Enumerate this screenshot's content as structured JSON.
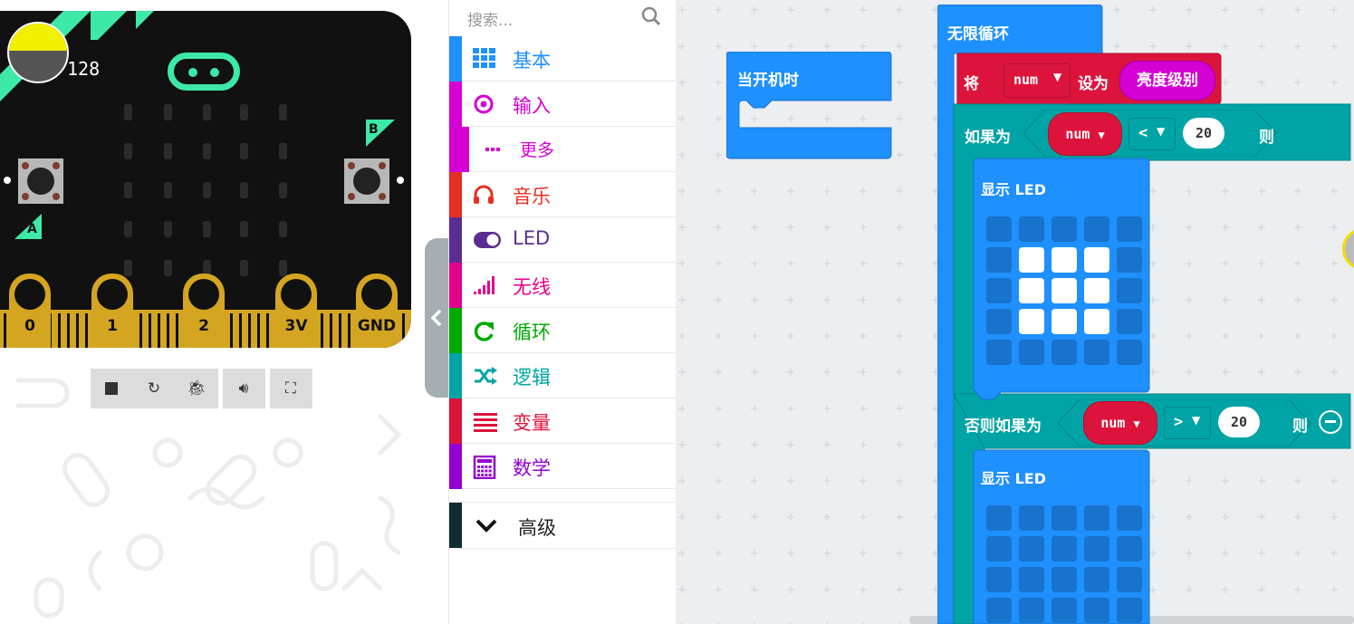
{
  "simulator": {
    "light_level": "128",
    "buttons": {
      "a": "A",
      "b": "B"
    },
    "pins": [
      "0",
      "1",
      "2",
      "3V",
      "GND"
    ],
    "controls": [
      "stop-icon",
      "restart-icon",
      "debug-icon",
      "mute-icon",
      "fullscreen-icon"
    ]
  },
  "toolbox": {
    "search_placeholder": "搜索...",
    "categories": [
      {
        "label": "基本",
        "color": "#1e90ff",
        "icon": "grid-icon"
      },
      {
        "label": "输入",
        "color": "#d400d4",
        "icon": "target-icon"
      },
      {
        "label": "更多",
        "color": "#d400d4",
        "icon": "dots-icon"
      },
      {
        "label": "音乐",
        "color": "#e63022",
        "icon": "headphones-icon"
      },
      {
        "label": "LED",
        "color": "#5c2d91",
        "icon": "toggle-icon"
      },
      {
        "label": "无线",
        "color": "#e3008c",
        "icon": "signal-icon"
      },
      {
        "label": "循环",
        "color": "#00aa00",
        "icon": "loop-icon"
      },
      {
        "label": "逻辑",
        "color": "#00a4a6",
        "icon": "shuffle-icon"
      },
      {
        "label": "变量",
        "color": "#dc143c",
        "icon": "list-icon"
      },
      {
        "label": "数学",
        "color": "#9400d3",
        "icon": "calculator-icon"
      }
    ],
    "advanced": "高级"
  },
  "workspace": {
    "on_start": "当开机时",
    "forever": "无限循环",
    "set_block": {
      "set": "将",
      "var": "num",
      "to": "设为",
      "value": "亮度级别"
    },
    "if_block": {
      "label": "如果为",
      "var": "num",
      "op": "<",
      "value": "20",
      "then": "则"
    },
    "show_led_1": "显示 LED",
    "led_pattern_1": [
      [
        0,
        0,
        0,
        0,
        0
      ],
      [
        0,
        1,
        1,
        1,
        0
      ],
      [
        0,
        1,
        1,
        1,
        0
      ],
      [
        0,
        1,
        1,
        1,
        0
      ],
      [
        0,
        0,
        0,
        0,
        0
      ]
    ],
    "elseif_block": {
      "label": "否则如果为",
      "var": "num",
      "op": ">",
      "value": "20",
      "then": "则"
    },
    "show_led_2": "显示 LED",
    "led_pattern_2": [
      [
        0,
        0,
        0,
        0,
        0
      ],
      [
        0,
        0,
        0,
        0,
        0
      ],
      [
        0,
        0,
        0,
        0,
        0
      ],
      [
        0,
        0,
        0,
        0,
        0
      ]
    ],
    "colors": {
      "basic": "#1e90ff",
      "variables": "#dc143c",
      "logic": "#00a4a6",
      "input": "#d400d4"
    }
  }
}
